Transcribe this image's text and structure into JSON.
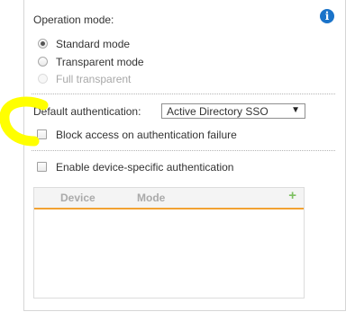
{
  "operation_mode": {
    "label": "Operation mode:",
    "options": [
      {
        "label": "Standard mode",
        "checked": true,
        "disabled": false
      },
      {
        "label": "Transparent mode",
        "checked": false,
        "disabled": false
      },
      {
        "label": "Full transparent",
        "checked": false,
        "disabled": true
      }
    ]
  },
  "default_authentication": {
    "label": "Default authentication:",
    "selected": "Active Directory SSO"
  },
  "checkboxes": {
    "block_access": "Block access on authentication failure",
    "device_specific": "Enable device-specific authentication"
  },
  "device_table": {
    "columns": [
      "Device",
      "Mode"
    ],
    "add_symbol": "+",
    "rows": []
  },
  "colors": {
    "highlight": "#ffff00",
    "accent": "#f2a233",
    "info": "#1a73c9",
    "add": "#7dc061"
  },
  "icons": {
    "info": "info-icon",
    "add": "plus-icon",
    "dropdown": "chevron-down-icon"
  }
}
